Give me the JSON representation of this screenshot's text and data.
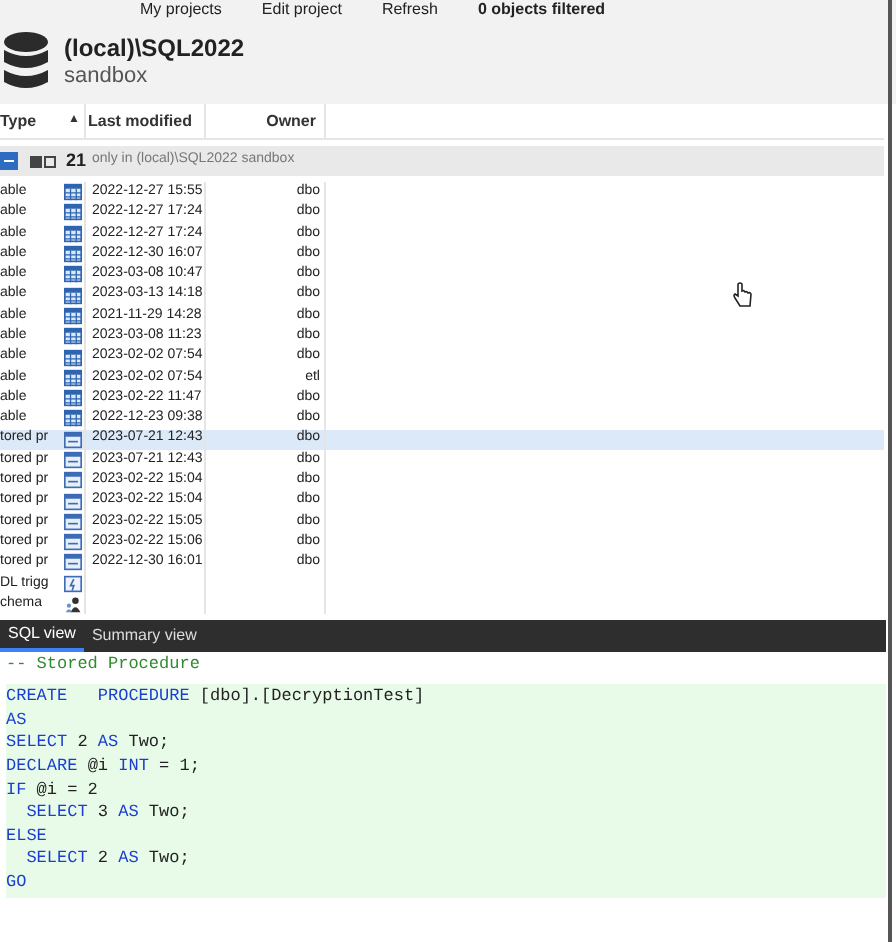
{
  "toolbar": {
    "items": [
      "My projects",
      "Edit project",
      "Refresh",
      "0 objects filtered"
    ]
  },
  "header": {
    "server": "(local)\\SQL2022",
    "database": "sandbox"
  },
  "table": {
    "columns": [
      {
        "label": "Type",
        "sort_arrow": "▲"
      },
      {
        "label": "Last modified"
      },
      {
        "label": "Owner"
      }
    ],
    "group": {
      "expanded": true,
      "count": "21",
      "label": "only in (local)\\SQL2022 sandbox"
    },
    "rows": [
      {
        "type": "able",
        "kind": "table",
        "modified": "2022-12-27 15:55",
        "owner": "dbo",
        "selected": false
      },
      {
        "type": "able",
        "kind": "table",
        "modified": "2022-12-27 17:24",
        "owner": "dbo",
        "selected": false
      },
      {
        "type": "able",
        "kind": "table",
        "modified": "2022-12-27 17:24",
        "owner": "dbo",
        "selected": false
      },
      {
        "type": "able",
        "kind": "table",
        "modified": "2022-12-30 16:07",
        "owner": "dbo",
        "selected": false
      },
      {
        "type": "able",
        "kind": "table",
        "modified": "2023-03-08 10:47",
        "owner": "dbo",
        "selected": false
      },
      {
        "type": "able",
        "kind": "table",
        "modified": "2023-03-13 14:18",
        "owner": "dbo",
        "selected": false
      },
      {
        "type": "able",
        "kind": "table",
        "modified": "2021-11-29 14:28",
        "owner": "dbo",
        "selected": false
      },
      {
        "type": "able",
        "kind": "table",
        "modified": "2023-03-08 11:23",
        "owner": "dbo",
        "selected": false
      },
      {
        "type": "able",
        "kind": "table",
        "modified": "2023-02-02 07:54",
        "owner": "dbo",
        "selected": false
      },
      {
        "type": "able",
        "kind": "table",
        "modified": "2023-02-02 07:54",
        "owner": "etl",
        "selected": false
      },
      {
        "type": "able",
        "kind": "table",
        "modified": "2023-02-22 11:47",
        "owner": "dbo",
        "selected": false
      },
      {
        "type": "able",
        "kind": "table",
        "modified": "2022-12-23 09:38",
        "owner": "dbo",
        "selected": false
      },
      {
        "type": "tored pr",
        "kind": "procedure",
        "modified": "2023-07-21 12:43",
        "owner": "dbo",
        "selected": true
      },
      {
        "type": "tored pr",
        "kind": "procedure",
        "modified": "2023-07-21 12:43",
        "owner": "dbo",
        "selected": false
      },
      {
        "type": "tored pr",
        "kind": "procedure",
        "modified": "2023-02-22 15:04",
        "owner": "dbo",
        "selected": false
      },
      {
        "type": "tored pr",
        "kind": "procedure",
        "modified": "2023-02-22 15:04",
        "owner": "dbo",
        "selected": false
      },
      {
        "type": "tored pr",
        "kind": "procedure",
        "modified": "2023-02-22 15:05",
        "owner": "dbo",
        "selected": false
      },
      {
        "type": "tored pr",
        "kind": "procedure",
        "modified": "2023-02-22 15:06",
        "owner": "dbo",
        "selected": false
      },
      {
        "type": "tored pr",
        "kind": "procedure",
        "modified": "2022-12-30 16:01",
        "owner": "dbo",
        "selected": false
      },
      {
        "type": "DL trigg",
        "kind": "trigger",
        "selected": false
      },
      {
        "type": "chema",
        "kind": "schema",
        "selected": false
      }
    ]
  },
  "tabs": [
    {
      "label": "SQL view",
      "selected": true
    },
    {
      "label": "Summary view",
      "selected": false
    }
  ],
  "sql": {
    "comment": "-- Stored Procedure",
    "lines": [
      [
        {
          "kind": "keyword",
          "text": "CREATE   PROCEDURE"
        },
        {
          "kind": "plain",
          "text": " [dbo].[DecryptionTest]"
        }
      ],
      [
        {
          "kind": "keyword",
          "text": "AS"
        }
      ],
      [
        {
          "kind": "keyword",
          "text": "SELECT"
        },
        {
          "kind": "plain",
          "text": " 2 "
        },
        {
          "kind": "keyword",
          "text": "AS"
        },
        {
          "kind": "plain",
          "text": " Two;"
        }
      ],
      [
        {
          "kind": "keyword",
          "text": "DECLARE"
        },
        {
          "kind": "plain",
          "text": " @i "
        },
        {
          "kind": "keyword",
          "text": "INT"
        },
        {
          "kind": "plain",
          "text": " = 1;"
        }
      ],
      [
        {
          "kind": "keyword",
          "text": "IF"
        },
        {
          "kind": "plain",
          "text": " @i = 2"
        }
      ],
      [
        {
          "kind": "indent"
        },
        {
          "kind": "keyword",
          "text": "SELECT"
        },
        {
          "kind": "plain",
          "text": " 3 "
        },
        {
          "kind": "keyword",
          "text": "AS"
        },
        {
          "kind": "plain",
          "text": " Two;"
        }
      ],
      [
        {
          "kind": "keyword",
          "text": "ELSE"
        }
      ],
      [
        {
          "kind": "indent"
        },
        {
          "kind": "keyword",
          "text": "SELECT"
        },
        {
          "kind": "plain",
          "text": " 2 "
        },
        {
          "kind": "keyword",
          "text": "AS"
        },
        {
          "kind": "plain",
          "text": " Two;"
        }
      ],
      [
        {
          "kind": "keyword",
          "text": "GO"
        }
      ]
    ]
  }
}
